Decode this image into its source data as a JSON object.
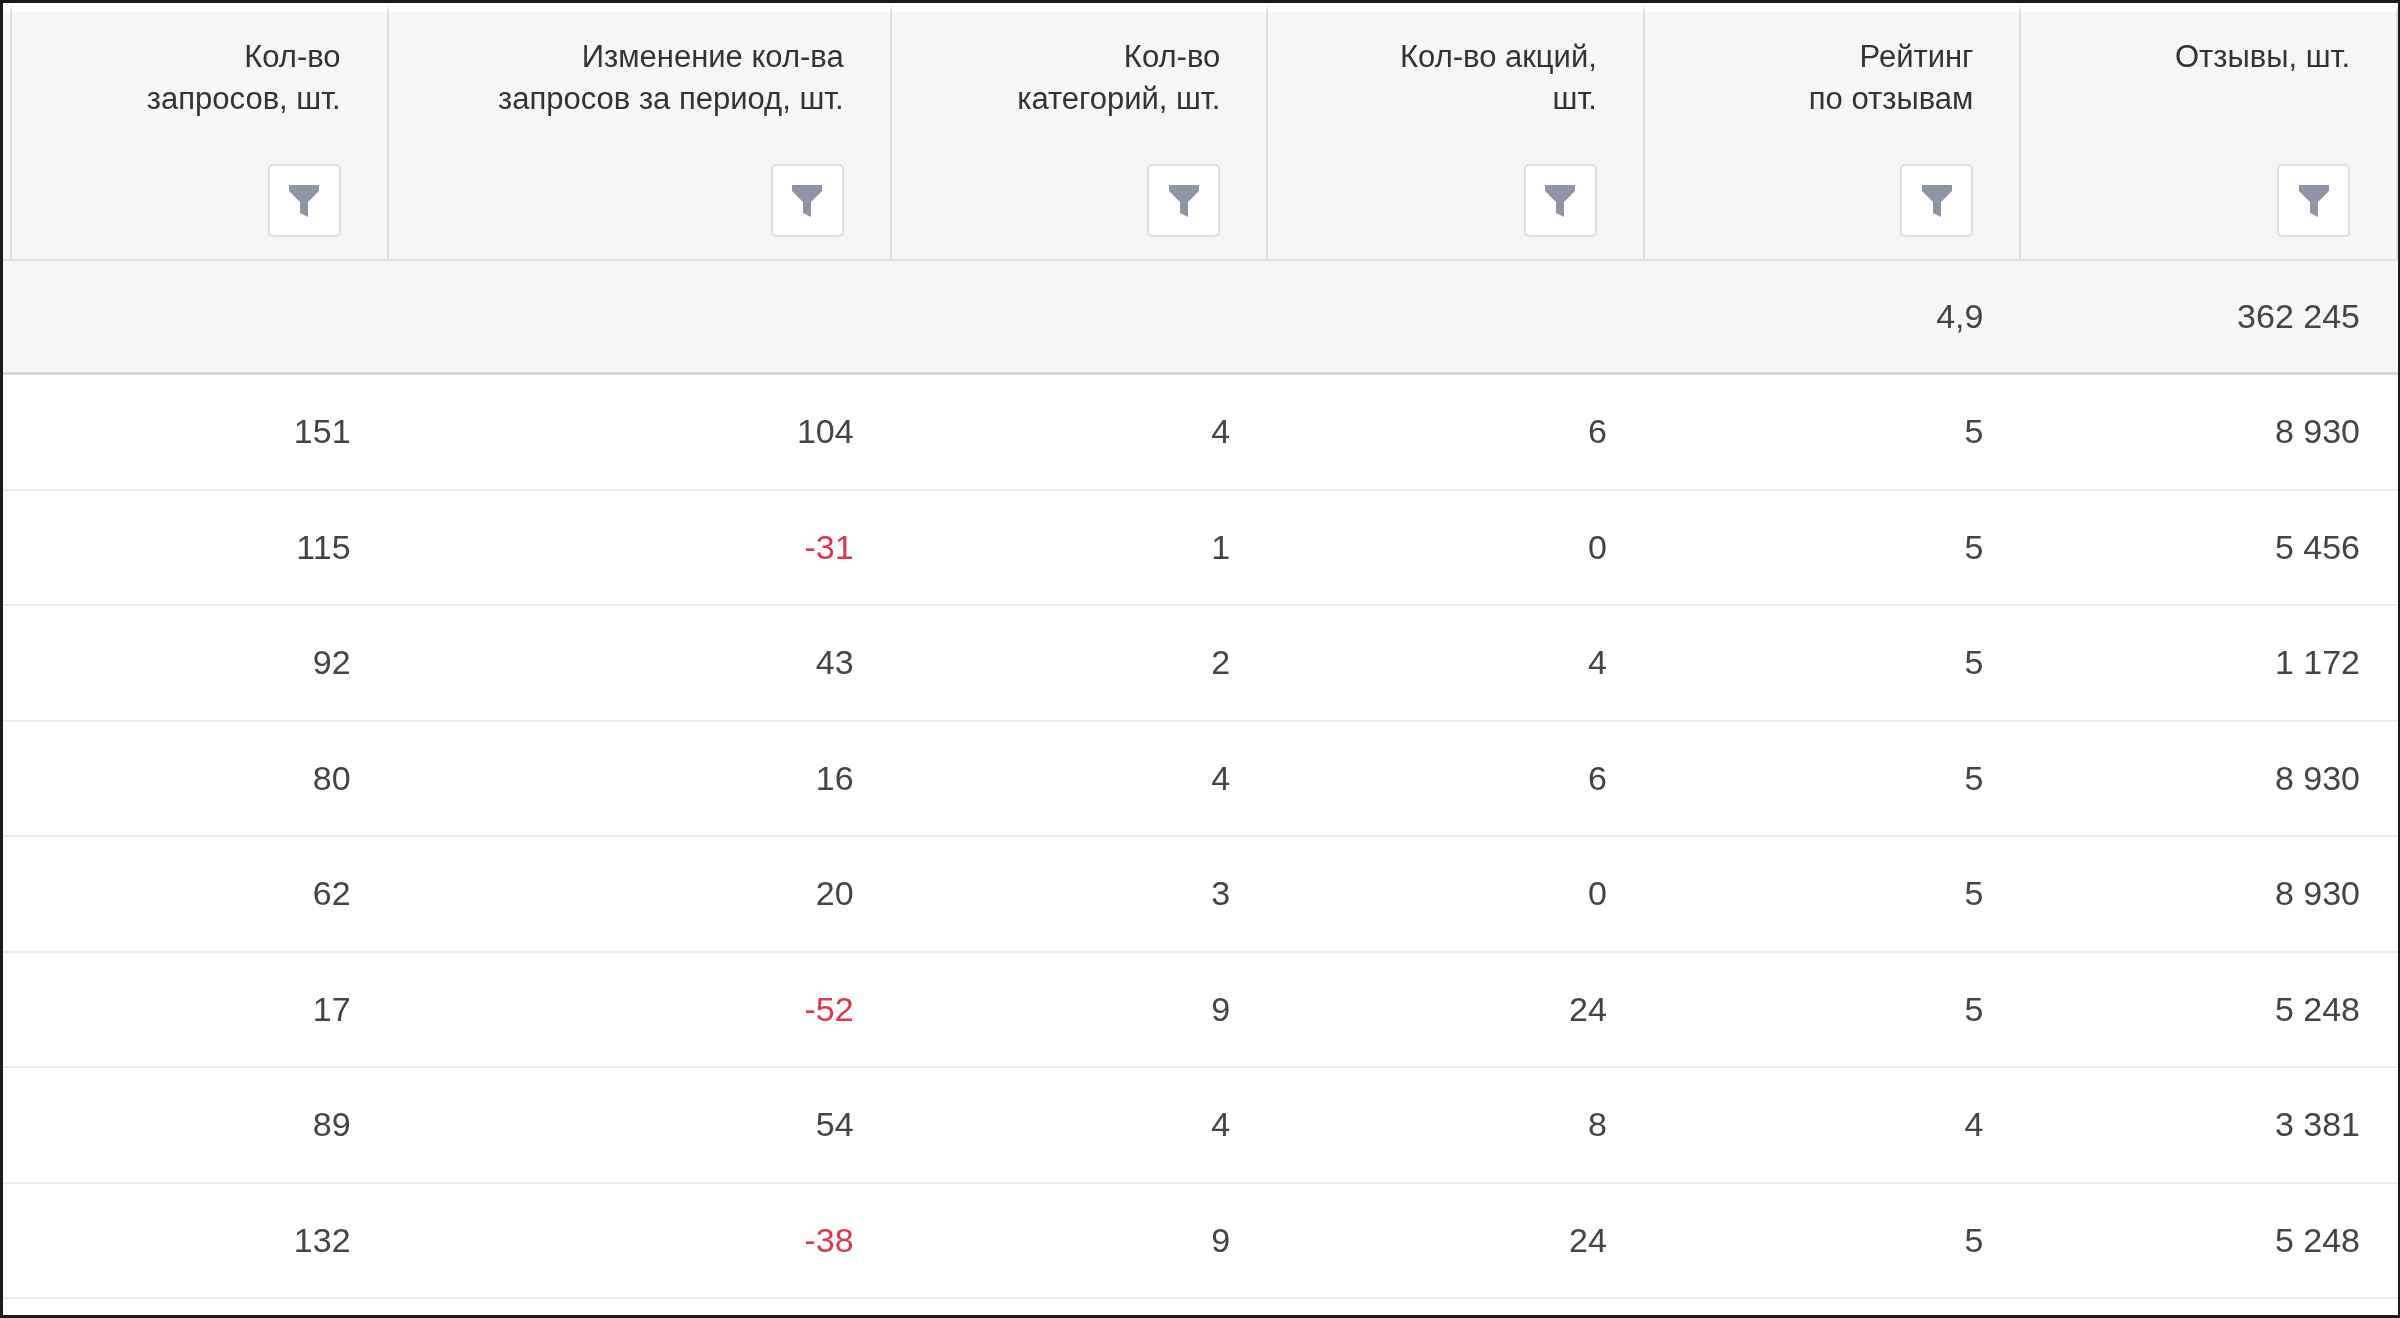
{
  "table": {
    "columns": [
      {
        "label": "Кол-во\nзапросов, шт."
      },
      {
        "label": "Изменение кол-ва\nзапросов за период, шт."
      },
      {
        "label": "Кол-во\nкатегорий, шт."
      },
      {
        "label": "Кол-во акций,\nшт."
      },
      {
        "label": "Рейтинг\nпо отзывам"
      },
      {
        "label": "Отзывы, шт."
      }
    ],
    "totals": {
      "rating": "4,9",
      "reviews": "362 245"
    },
    "rows": [
      {
        "cells": [
          "151",
          "104",
          "4",
          "6",
          "5",
          "8 930"
        ],
        "change_negative": false
      },
      {
        "cells": [
          "115",
          "-31",
          "1",
          "0",
          "5",
          "5 456"
        ],
        "change_negative": true
      },
      {
        "cells": [
          "92",
          "43",
          "2",
          "4",
          "5",
          "1 172"
        ],
        "change_negative": false
      },
      {
        "cells": [
          "80",
          "16",
          "4",
          "6",
          "5",
          "8 930"
        ],
        "change_negative": false
      },
      {
        "cells": [
          "62",
          "20",
          "3",
          "0",
          "5",
          "8 930"
        ],
        "change_negative": false
      },
      {
        "cells": [
          "17",
          "-52",
          "9",
          "24",
          "5",
          "5 248"
        ],
        "change_negative": true
      },
      {
        "cells": [
          "89",
          "54",
          "4",
          "8",
          "4",
          "3 381"
        ],
        "change_negative": false
      },
      {
        "cells": [
          "132",
          "-38",
          "9",
          "24",
          "5",
          "5 248"
        ],
        "change_negative": true
      }
    ]
  }
}
